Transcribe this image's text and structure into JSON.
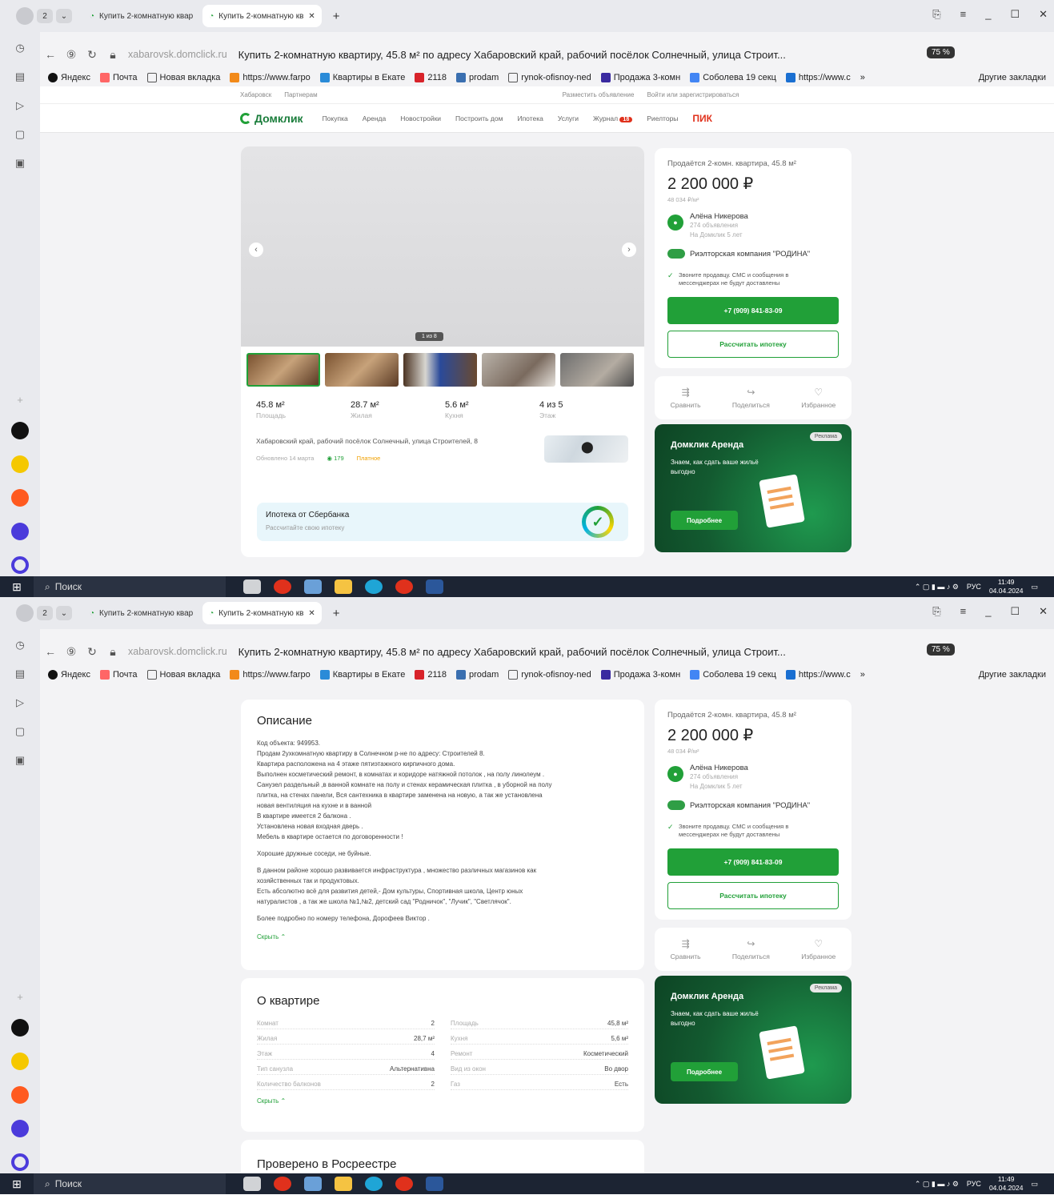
{
  "browser": {
    "tab_count": "2",
    "tabs": [
      {
        "label": "Купить 2-комнатную квар"
      },
      {
        "label": "Купить 2-комнатную кв"
      }
    ],
    "new_tab": "+",
    "page_domain": "xabarovsk.domclick.ru",
    "page_title": "Купить 2-комнатную квартиру, 45.8 м² по адресу Хабаровский край, рабочий посёлок Солнечный, улица Строит...",
    "zoom": "75 %",
    "bookmarks": [
      "Яндекс",
      "Почта",
      "Новая вкладка",
      "https://www.farpo",
      "Квартиры в Екате",
      "2118",
      "prodam",
      "rynok-ofisnoy-ned",
      "Продажа 3-комн",
      "Соболева 19 секц",
      "https://www.c"
    ],
    "more_bookmarks": "»",
    "other_bookmarks": "Другие закладки"
  },
  "site": {
    "top_links": [
      "Хабаровск",
      "Партнерам",
      "Разместить объявление",
      "Войти или зарегистрироваться"
    ],
    "logo": "Домклик",
    "nav": [
      "Покупка",
      "Аренда",
      "Новостройки",
      "Построить дом",
      "Ипотека",
      "Услуги",
      "Журнал",
      "Риелторы"
    ],
    "journal_badge": "18",
    "pik": "ПИК"
  },
  "listing": {
    "photo_counter": "1 из 8",
    "stats": [
      {
        "value": "45.8 м²",
        "label": "Площадь"
      },
      {
        "value": "28.7 м²",
        "label": "Жилая"
      },
      {
        "value": "5.6 м²",
        "label": "Кухня"
      },
      {
        "value": "4 из 5",
        "label": "Этаж"
      }
    ],
    "address": "Хабаровский край, рабочий посёлок Солнечный, улица Строителей, 8",
    "updated": "Обновлено 14 марта",
    "views": "179",
    "paid": "Платное",
    "mortgage_title": "Ипотека от Сбербанка",
    "mortgage_sub": "Рассчитайте свою ипотеку"
  },
  "sidebar": {
    "title": "Продаётся 2-комн. квартира, 45.8 м²",
    "price": "2 200 000 ₽",
    "price_per_m2": "48 034 ₽/м²",
    "agent_name": "Алёна Никерова",
    "agent_ads": "274 объявления",
    "agent_since": "На Домклик 5 лет",
    "agency": "Риэлторская компания \"РОДИНА\"",
    "notice": "Звоните продавцу. СМС и сообщения в мессенджерах не будут доставлены",
    "phone": "+7 (909) 841-83-09",
    "calc": "Рассчитать ипотеку",
    "actions": [
      "Сравнить",
      "Поделиться",
      "Избранное"
    ],
    "promo_title": "Домклик Аренда",
    "promo_desc": "Знаем, как сдать ваше жильё выгодно",
    "promo_btn": "Подробнее",
    "promo_ad": "Реклама"
  },
  "description": {
    "title": "Описание",
    "lines": [
      "Код объекта: 949953.",
      "Продам 2ухкомнатную квартиру в Солнечном р-не по адресу: Строителей 8.",
      "Квартира расположена на 4 этаже пятиэтажного кирпичного дома.",
      "Выполнен косметический ремонт, в комнатах и коридоре натяжной потолок , на полу линолеум .",
      "Санузел раздельный ,в ванной комнате на полу и стенах керамическая плитка , в уборной на полу",
      "плитка, на стенах панели, Вся сантехника в квартире заменена на новую, а так же установлена",
      "новая вентиляция на кухне и в ванной",
      "В квартире имеется 2 балкона .",
      "Установлена новая входная дверь .",
      "Мебель в квартире остается по договоренности !",
      "",
      "Хорошие дружные соседи, не буйные.",
      "",
      "В данном районе хорошо развивается инфраструктура , множество различных магазинов как",
      "хозяйственных так и продуктовых.",
      "Есть абсолютно всё для развития детей,- Дом культуры, Спортивная школа, Центр юных",
      "натуралистов , а так же школа №1,№2, детский сад \"Родничок\", \"Лучик\", \"Светлячок\".",
      "",
      "Более подробно по номеру телефона, Дорофеев Виктор ."
    ],
    "hide": "Скрыть"
  },
  "about": {
    "title": "О квартире",
    "rows": [
      {
        "k": "Комнат",
        "v": "2"
      },
      {
        "k": "Площадь",
        "v": "45,8 м²"
      },
      {
        "k": "Жилая",
        "v": "28,7 м²"
      },
      {
        "k": "Кухня",
        "v": "5,6 м²"
      },
      {
        "k": "Этаж",
        "v": "4"
      },
      {
        "k": "Ремонт",
        "v": "Косметический"
      },
      {
        "k": "Тип санузла",
        "v": "Альтернативна"
      },
      {
        "k": "Вид из окон",
        "v": "Во двор"
      },
      {
        "k": "Количество балконов",
        "v": "2"
      },
      {
        "k": "Газ",
        "v": "Есть"
      }
    ],
    "hide": "Скрыть"
  },
  "verified_title": "Проверено в Росреестре",
  "taskbar": {
    "search": "Поиск",
    "lang": "РУС",
    "time": "11:49",
    "date": "04.04.2024"
  }
}
